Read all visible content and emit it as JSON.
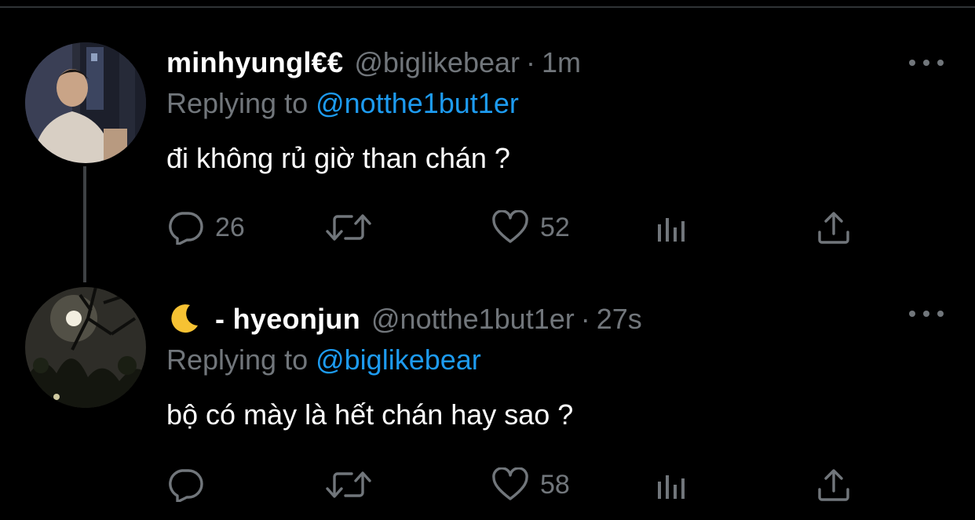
{
  "tweets": [
    {
      "display_name": "minhyungl€€",
      "handle": "@biglikebear",
      "separator": "·",
      "time": "1m",
      "replying_prefix": "Replying to",
      "replying_to": "@notthe1but1er",
      "text": "đi không rủ giờ than chán ?",
      "replies": "26",
      "retweets": "",
      "likes": "52"
    },
    {
      "display_emoji": "moon-emoji",
      "display_name": "- hyeonjun",
      "handle": "@notthe1but1er",
      "separator": "·",
      "time": "27s",
      "replying_prefix": "Replying to",
      "replying_to": "@biglikebear",
      "text": "bộ có mày là hết chán hay sao ?",
      "replies": "",
      "retweets": "",
      "likes": "58"
    }
  ],
  "icons": [
    "reply-icon",
    "retweet-icon",
    "like-icon",
    "analytics-icon",
    "share-icon",
    "more-icon"
  ],
  "colors": {
    "background": "#000000",
    "text": "#ffffff",
    "muted": "#71767b",
    "link": "#1d9bf0",
    "thread_line": "#3e4144"
  }
}
